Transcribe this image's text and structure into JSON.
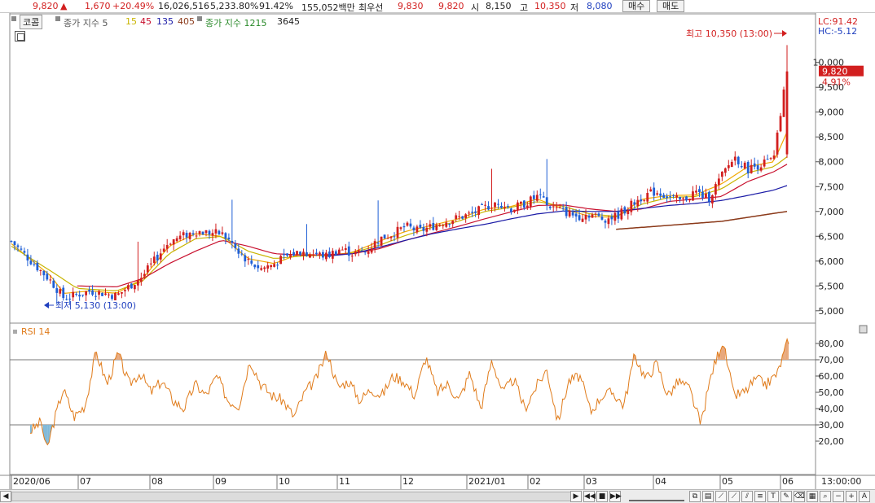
{
  "topbar": {
    "price": "9,820",
    "arrow": "▲",
    "change": "1,670",
    "change_pct": "+20.49%",
    "volume": "16,026,516",
    "vol_ratio": "5,233.80%",
    "turnover": "91.42%",
    "amount": "155,052백만",
    "best_label": "최우선",
    "ask": "9,830",
    "bid": "9,820",
    "open_label": "시",
    "open": "8,150",
    "high_label": "고",
    "high": "10,350",
    "low_label": "저",
    "low": "8,080",
    "buy_button": "매수",
    "sell_button": "매도"
  },
  "legend": {
    "stock_name": "코콤",
    "ma_label": "종가 지수 5",
    "ma15": "15",
    "ma45": "45",
    "ma135": "135",
    "ma405": "405",
    "vol_label": "종가 지수 1215",
    "vol_val": "3645"
  },
  "right_info": {
    "lc": "LC:91.42",
    "hc": "HC:-5.12"
  },
  "annotations": {
    "high": "최고 10,350 (13:00)",
    "low": "최저 5,130 (13:00)",
    "current_price": "9,820",
    "current_pct": "4.91%"
  },
  "rsi_label": "RSI 14",
  "time_label": "13:00:00",
  "colors": {
    "up": "#d21f1f",
    "down": "#1f5fd6",
    "ma5": "#f2a900",
    "ma15": "#c8b400",
    "ma45": "#c8102e",
    "ma135": "#1a1aa6",
    "ma405": "#8b3a1a",
    "rsi": "#e07b1a",
    "rsi_over": "#e8a77a",
    "rsi_under": "#7fb8d8"
  },
  "chart_data": [
    {
      "type": "candlestick",
      "title": "코콤",
      "ylim": [
        4800,
        10700
      ],
      "yticks": [
        5000,
        5500,
        6000,
        6500,
        7000,
        7500,
        8000,
        8500,
        9000,
        9500,
        10000
      ],
      "ytick_labels": [
        "5,000",
        "5,500",
        "6,000",
        "6,500",
        "7,000",
        "7,500",
        "8,000",
        "8,500",
        "9,000",
        "9,500",
        "10,000"
      ],
      "x_categories": [
        "2020/06",
        "07",
        "08",
        "09",
        "10",
        "11",
        "12",
        "2021/01",
        "02",
        "03",
        "04",
        "05",
        "06"
      ],
      "close_anchors": [
        [
          0,
          6400
        ],
        [
          3,
          5600
        ],
        [
          4,
          5250
        ],
        [
          6,
          5400
        ],
        [
          8,
          5300
        ],
        [
          10,
          5700
        ],
        [
          12,
          6400
        ],
        [
          14,
          6600
        ],
        [
          16,
          6550
        ],
        [
          17,
          6300
        ],
        [
          18,
          6000
        ],
        [
          19,
          5850
        ],
        [
          20,
          5950
        ],
        [
          21,
          6100
        ],
        [
          22,
          6200
        ],
        [
          23,
          6150
        ],
        [
          24,
          6100
        ],
        [
          25,
          6250
        ],
        [
          26,
          6150
        ],
        [
          27,
          6200
        ],
        [
          28,
          6450
        ],
        [
          29,
          6550
        ],
        [
          30,
          6700
        ],
        [
          31,
          6600
        ],
        [
          33,
          6800
        ],
        [
          35,
          6950
        ],
        [
          37,
          7200
        ],
        [
          38,
          7050
        ],
        [
          39,
          7150
        ],
        [
          40,
          7300
        ],
        [
          41,
          7100
        ],
        [
          42,
          7000
        ],
        [
          43,
          6900
        ],
        [
          44,
          6950
        ],
        [
          45,
          6850
        ],
        [
          46,
          6900
        ],
        [
          47,
          7100
        ],
        [
          48,
          7300
        ],
        [
          49,
          7400
        ],
        [
          50,
          7300
        ],
        [
          51,
          7200
        ],
        [
          52,
          7400
        ],
        [
          53,
          7250
        ],
        [
          54,
          7700
        ],
        [
          55,
          8100
        ],
        [
          56,
          7850
        ],
        [
          57,
          7950
        ],
        [
          58,
          8050
        ],
        [
          59,
          9820
        ]
      ],
      "series": [
        {
          "name": "5",
          "anchors": [
            [
              0,
              6350
            ],
            [
              3,
              5700
            ],
            [
              4,
              5350
            ],
            [
              6,
              5400
            ],
            [
              8,
              5350
            ],
            [
              10,
              5650
            ],
            [
              12,
              6300
            ],
            [
              14,
              6550
            ],
            [
              16,
              6500
            ],
            [
              18,
              6050
            ],
            [
              20,
              5950
            ],
            [
              22,
              6150
            ],
            [
              24,
              6100
            ],
            [
              26,
              6180
            ],
            [
              28,
              6400
            ],
            [
              30,
              6600
            ],
            [
              32,
              6720
            ],
            [
              34,
              6850
            ],
            [
              36,
              7050
            ],
            [
              38,
              7100
            ],
            [
              40,
              7250
            ],
            [
              42,
              7050
            ],
            [
              44,
              6900
            ],
            [
              46,
              6880
            ],
            [
              48,
              7250
            ],
            [
              50,
              7320
            ],
            [
              52,
              7330
            ],
            [
              54,
              7550
            ],
            [
              56,
              7900
            ],
            [
              58,
              8000
            ],
            [
              59,
              8600
            ]
          ]
        },
        {
          "name": "15",
          "anchors": [
            [
              0,
              6300
            ],
            [
              3,
              5800
            ],
            [
              5,
              5450
            ],
            [
              8,
              5400
            ],
            [
              10,
              5600
            ],
            [
              12,
              6150
            ],
            [
              14,
              6450
            ],
            [
              16,
              6500
            ],
            [
              18,
              6200
            ],
            [
              20,
              6050
            ],
            [
              22,
              6100
            ],
            [
              24,
              6120
            ],
            [
              26,
              6170
            ],
            [
              28,
              6320
            ],
            [
              30,
              6520
            ],
            [
              32,
              6680
            ],
            [
              34,
              6800
            ],
            [
              36,
              7000
            ],
            [
              38,
              7080
            ],
            [
              40,
              7200
            ],
            [
              42,
              7100
            ],
            [
              44,
              6950
            ],
            [
              46,
              6900
            ],
            [
              48,
              7150
            ],
            [
              50,
              7280
            ],
            [
              52,
              7300
            ],
            [
              54,
              7450
            ],
            [
              56,
              7780
            ],
            [
              58,
              7900
            ],
            [
              59,
              8100
            ]
          ]
        },
        {
          "name": "45",
          "anchors": [
            [
              5,
              5500
            ],
            [
              8,
              5480
            ],
            [
              10,
              5650
            ],
            [
              12,
              5950
            ],
            [
              14,
              6200
            ],
            [
              16,
              6420
            ],
            [
              18,
              6300
            ],
            [
              20,
              6150
            ],
            [
              22,
              6120
            ],
            [
              24,
              6130
            ],
            [
              26,
              6150
            ],
            [
              28,
              6250
            ],
            [
              30,
              6420
            ],
            [
              32,
              6560
            ],
            [
              34,
              6700
            ],
            [
              36,
              6850
            ],
            [
              38,
              6990
            ],
            [
              40,
              7120
            ],
            [
              42,
              7130
            ],
            [
              44,
              7050
            ],
            [
              46,
              7000
            ],
            [
              48,
              7050
            ],
            [
              50,
              7200
            ],
            [
              52,
              7250
            ],
            [
              54,
              7300
            ],
            [
              56,
              7600
            ],
            [
              58,
              7800
            ],
            [
              59,
              7950
            ]
          ]
        },
        {
          "name": "135",
          "anchors": [
            [
              24,
              6100
            ],
            [
              26,
              6150
            ],
            [
              28,
              6280
            ],
            [
              30,
              6420
            ],
            [
              32,
              6550
            ],
            [
              34,
              6650
            ],
            [
              36,
              6740
            ],
            [
              38,
              6850
            ],
            [
              40,
              6950
            ],
            [
              42,
              7010
            ],
            [
              44,
              7000
            ],
            [
              46,
              7000
            ],
            [
              48,
              7060
            ],
            [
              50,
              7120
            ],
            [
              52,
              7160
            ],
            [
              54,
              7220
            ],
            [
              56,
              7320
            ],
            [
              58,
              7430
            ],
            [
              59,
              7520
            ]
          ]
        },
        {
          "name": "405",
          "anchors": [
            [
              46,
              6640
            ],
            [
              50,
              6720
            ],
            [
              54,
              6800
            ],
            [
              57,
              6920
            ],
            [
              59,
              7000
            ]
          ]
        }
      ]
    },
    {
      "type": "line",
      "title": "RSI 14",
      "ylim": [
        0,
        87
      ],
      "yticks": [
        20,
        30,
        40,
        50,
        60,
        70,
        80
      ],
      "ytick_labels": [
        "20,00",
        "30,00",
        "40,00",
        "50,00",
        "60,00",
        "70,00",
        "80,00"
      ],
      "bands": [
        30,
        70
      ],
      "series": [
        {
          "name": "RSI 14",
          "anchors": [
            [
              0,
              26
            ],
            [
              1,
              32
            ],
            [
              1.5,
              14
            ],
            [
              2,
              28
            ],
            [
              3,
              52
            ],
            [
              4,
              35
            ],
            [
              5,
              42
            ],
            [
              6,
              75
            ],
            [
              7,
              55
            ],
            [
              8,
              74
            ],
            [
              9,
              55
            ],
            [
              10,
              62
            ],
            [
              11,
              50
            ],
            [
              12,
              57
            ],
            [
              13,
              45
            ],
            [
              14,
              40
            ],
            [
              15,
              55
            ],
            [
              16,
              48
            ],
            [
              17,
              60
            ],
            [
              18,
              45
            ],
            [
              19,
              42
            ],
            [
              20,
              70
            ],
            [
              21,
              55
            ],
            [
              22,
              48
            ],
            [
              23,
              45
            ],
            [
              24,
              35
            ],
            [
              25,
              50
            ],
            [
              26,
              58
            ],
            [
              27,
              75
            ],
            [
              28,
              53
            ],
            [
              29,
              57
            ],
            [
              30,
              45
            ],
            [
              31,
              52
            ],
            [
              32,
              48
            ],
            [
              33,
              60
            ],
            [
              34,
              57
            ],
            [
              35,
              48
            ],
            [
              36,
              72
            ],
            [
              37,
              50
            ],
            [
              38,
              55
            ],
            [
              39,
              45
            ],
            [
              40,
              62
            ],
            [
              41,
              40
            ],
            [
              42,
              70
            ],
            [
              43,
              50
            ],
            [
              44,
              58
            ],
            [
              45,
              40
            ],
            [
              46,
              53
            ],
            [
              47,
              64
            ],
            [
              48,
              32
            ],
            [
              49,
              57
            ],
            [
              50,
              60
            ],
            [
              51,
              38
            ],
            [
              52,
              48
            ],
            [
              53,
              50
            ],
            [
              54,
              42
            ],
            [
              55,
              73
            ],
            [
              56,
              58
            ],
            [
              57,
              68
            ],
            [
              58,
              48
            ],
            [
              59,
              57
            ],
            [
              60,
              52
            ],
            [
              61,
              30
            ],
            [
              62,
              62
            ],
            [
              63,
              82
            ],
            [
              64,
              48
            ],
            [
              65,
              50
            ],
            [
              66,
              58
            ],
            [
              67,
              55
            ],
            [
              68,
              62
            ],
            [
              69,
              83
            ]
          ]
        }
      ]
    }
  ]
}
